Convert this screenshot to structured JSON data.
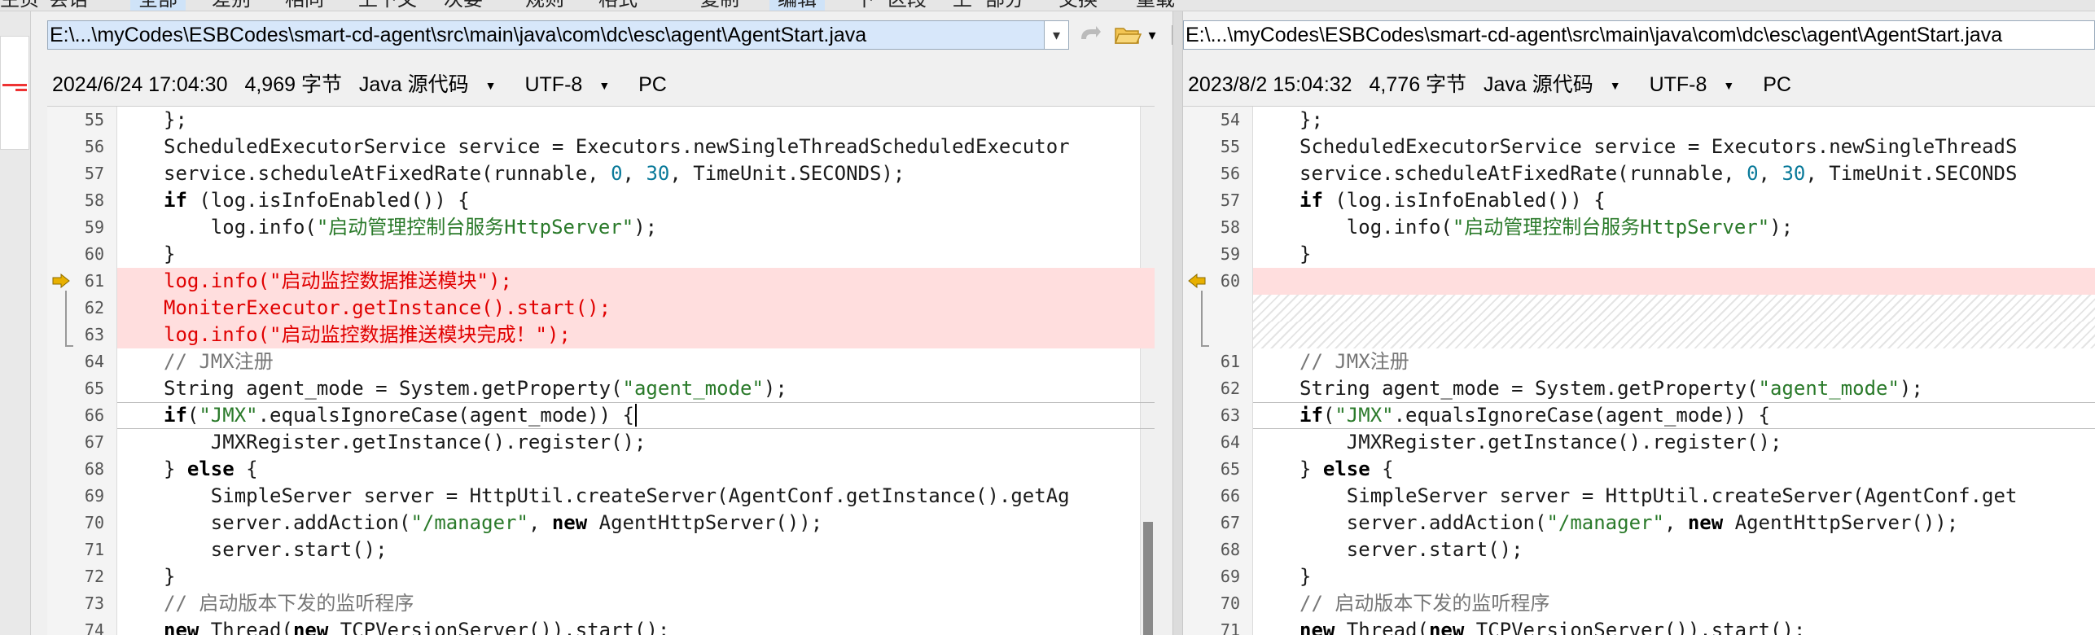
{
  "toolbar": {
    "items": [
      "主页",
      "会话",
      "全部",
      "差别",
      "相同",
      "上下文",
      "次要",
      "规则",
      "格式",
      "复制",
      "编辑",
      "下",
      "区段",
      "上",
      "部分",
      "交换",
      "重载"
    ]
  },
  "left": {
    "path": "E:\\...\\myCodes\\ESBCodes\\smart-cd-agent\\src\\main\\java\\com\\dc\\esc\\agent\\AgentStart.java",
    "info": {
      "datetime": "2024/6/24 17:04:30",
      "size": "4,969 字节",
      "format": "Java 源代码",
      "encoding": "UTF-8",
      "lineend": "PC"
    },
    "lines": [
      {
        "n": "55",
        "code": "        };",
        "type": "normal"
      },
      {
        "n": "56",
        "code": "        ScheduledExecutorService service = Executors.newSingleThreadScheduledExecutor",
        "type": "normal"
      },
      {
        "n": "57",
        "code": "        service.scheduleAtFixedRate(runnable, 0, 30, TimeUnit.SECONDS);",
        "type": "normal"
      },
      {
        "n": "58",
        "code": "        if (log.isInfoEnabled()) {",
        "type": "normal"
      },
      {
        "n": "59",
        "code": "            log.info(\"启动管理控制台服务HttpServer\");",
        "type": "normal"
      },
      {
        "n": "60",
        "code": "        }",
        "type": "normal"
      },
      {
        "n": "61",
        "code": "        log.info(\"启动监控数据推送模块\");",
        "type": "changed"
      },
      {
        "n": "62",
        "code": "        MoniterExecutor.getInstance().start();",
        "type": "changed"
      },
      {
        "n": "63",
        "code": "        log.info(\"启动监控数据推送模块完成！\");",
        "type": "changed"
      },
      {
        "n": "64",
        "code": "        // JMX注册",
        "type": "normal"
      },
      {
        "n": "65",
        "code": "        String agent_mode = System.getProperty(\"agent_mode\");",
        "type": "normal"
      },
      {
        "n": "66",
        "code": "        if(\"JMX\".equalsIgnoreCase(agent_mode)) {|",
        "type": "cursor"
      },
      {
        "n": "67",
        "code": "            JMXRegister.getInstance().register();",
        "type": "normal"
      },
      {
        "n": "68",
        "code": "        } else {",
        "type": "normal"
      },
      {
        "n": "69",
        "code": "            SimpleServer server = HttpUtil.createServer(AgentConf.getInstance().getAg",
        "type": "normal"
      },
      {
        "n": "70",
        "code": "            server.addAction(\"/manager\", new AgentHttpServer());",
        "type": "normal"
      },
      {
        "n": "71",
        "code": "            server.start();",
        "type": "normal"
      },
      {
        "n": "72",
        "code": "        }",
        "type": "normal"
      },
      {
        "n": "73",
        "code": "        // 启动版本下发的监听程序",
        "type": "normal"
      },
      {
        "n": "74",
        "code": "        new Thread(new TCPVersionServer()).start();",
        "type": "normal"
      }
    ]
  },
  "right": {
    "path": "E:\\...\\myCodes\\ESBCodes\\smart-cd-agent\\src\\main\\java\\com\\dc\\esc\\agent\\AgentStart.java",
    "info": {
      "datetime": "2023/8/2 15:04:32",
      "size": "4,776 字节",
      "format": "Java 源代码",
      "encoding": "UTF-8",
      "lineend": "PC"
    },
    "lines": [
      {
        "n": "54",
        "code": "        };",
        "type": "normal"
      },
      {
        "n": "55",
        "code": "        ScheduledExecutorService service = Executors.newSingleThreadS",
        "type": "normal"
      },
      {
        "n": "56",
        "code": "        service.scheduleAtFixedRate(runnable, 0, 30, TimeUnit.SECONDS",
        "type": "normal"
      },
      {
        "n": "57",
        "code": "        if (log.isInfoEnabled()) {",
        "type": "normal"
      },
      {
        "n": "58",
        "code": "            log.info(\"启动管理控制台服务HttpServer\");",
        "type": "normal"
      },
      {
        "n": "59",
        "code": "        }",
        "type": "normal"
      },
      {
        "n": "60",
        "code": "",
        "type": "gap"
      },
      {
        "n": "",
        "code": "",
        "type": "hatch"
      },
      {
        "n": "",
        "code": "",
        "type": "hatch"
      },
      {
        "n": "61",
        "code": "        // JMX注册",
        "type": "normal"
      },
      {
        "n": "62",
        "code": "        String agent_mode = System.getProperty(\"agent_mode\");",
        "type": "normal"
      },
      {
        "n": "63",
        "code": "        if(\"JMX\".equalsIgnoreCase(agent_mode)) {",
        "type": "cursor"
      },
      {
        "n": "64",
        "code": "            JMXRegister.getInstance().register();",
        "type": "normal"
      },
      {
        "n": "65",
        "code": "        } else {",
        "type": "normal"
      },
      {
        "n": "66",
        "code": "            SimpleServer server = HttpUtil.createServer(AgentConf.get",
        "type": "normal"
      },
      {
        "n": "67",
        "code": "            server.addAction(\"/manager\", new AgentHttpServer());",
        "type": "normal"
      },
      {
        "n": "68",
        "code": "            server.start();",
        "type": "normal"
      },
      {
        "n": "69",
        "code": "        }",
        "type": "normal"
      },
      {
        "n": "70",
        "code": "        // 启动版本下发的监听程序",
        "type": "normal"
      },
      {
        "n": "71",
        "code": "        new Thread(new TCPVersionServer()).start();",
        "type": "normal"
      }
    ]
  },
  "colors": {
    "diff_bg": "#ffdede",
    "diff_text": "#e00000",
    "string": "#2a7a2a",
    "arrow": "#e8b000"
  }
}
